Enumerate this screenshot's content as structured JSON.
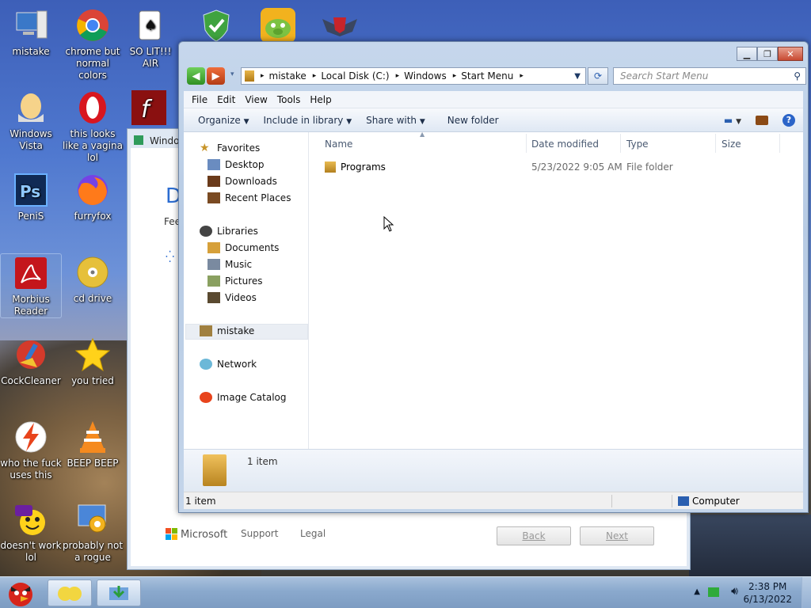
{
  "desktop": {
    "icons": [
      {
        "label": "mistake",
        "icon": "computer-icon"
      },
      {
        "label": "chrome but normal colors",
        "icon": "chrome-icon"
      },
      {
        "label": "SO LIT!!! AIR",
        "icon": "cards-icon"
      },
      {
        "label": "",
        "icon": "shield-icon"
      },
      {
        "label": "",
        "icon": "pig-icon"
      },
      {
        "label": "",
        "icon": "emblem-icon"
      },
      {
        "label": "Windows Vista",
        "icon": "egg-icon"
      },
      {
        "label": "this looks like a vagina lol",
        "icon": "opera-icon"
      },
      {
        "label": "",
        "icon": "flash-icon"
      },
      {
        "label": "PeniS",
        "icon": "photoshop-icon"
      },
      {
        "label": "furryfox",
        "icon": "firefox-icon"
      },
      {
        "label": "Morbius Reader",
        "icon": "pdf-icon"
      },
      {
        "label": "cd drive",
        "icon": "cd-icon"
      },
      {
        "label": "CockCleaner",
        "icon": "broom-icon"
      },
      {
        "label": "you tried",
        "icon": "star-icon"
      },
      {
        "label": "who the fuck uses this",
        "icon": "bolt-icon"
      },
      {
        "label": "BEEP BEEP",
        "icon": "vlc-icon"
      },
      {
        "label": "doesn't work lol",
        "icon": "yahoo-icon"
      },
      {
        "label": "probably not a rogue",
        "icon": "gears-icon"
      }
    ]
  },
  "wizard": {
    "title": "Windo",
    "partial_text": "Fee",
    "microsoft": "Microsoft",
    "support": "Support",
    "legal": "Legal",
    "back": "Back",
    "next": "Next"
  },
  "explorer": {
    "breadcrumb": [
      "mistake",
      "Local Disk (C:)",
      "Windows",
      "Start Menu"
    ],
    "search_placeholder": "Search Start Menu",
    "menu": [
      "File",
      "Edit",
      "View",
      "Tools",
      "Help"
    ],
    "toolbar": [
      "Organize",
      "Include in library",
      "Share with",
      "New folder"
    ],
    "nav": {
      "favorites": "Favorites",
      "favorites_items": [
        "Desktop",
        "Downloads",
        "Recent Places"
      ],
      "libraries": "Libraries",
      "libraries_items": [
        "Documents",
        "Music",
        "Pictures",
        "Videos"
      ],
      "user": "mistake",
      "network": "Network",
      "image_catalog": "Image Catalog"
    },
    "columns": [
      "Name",
      "Date modified",
      "Type",
      "Size"
    ],
    "rows": [
      {
        "name": "Programs",
        "date": "5/23/2022 9:05 AM",
        "type": "File folder",
        "size": ""
      }
    ],
    "details_count": "1 item",
    "status_left": "1 item",
    "status_right": "Computer"
  },
  "taskbar": {
    "time": "2:38 PM",
    "date": "6/13/2022"
  }
}
